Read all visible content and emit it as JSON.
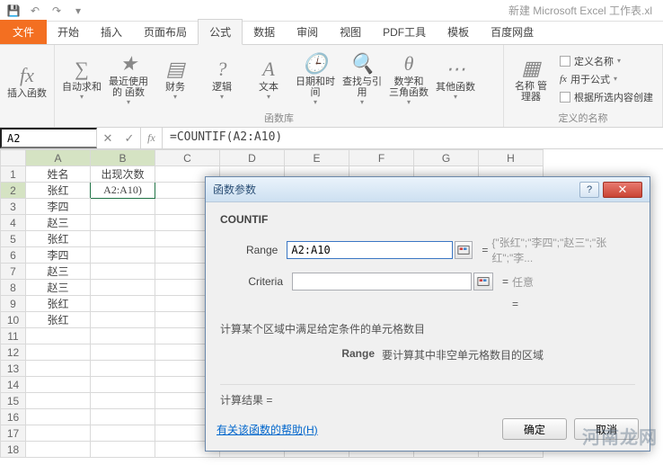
{
  "app": {
    "documentTitle": "新建 Microsoft Excel 工作表.xl"
  },
  "tabs": {
    "file": "文件",
    "home": "开始",
    "insert": "插入",
    "layout": "页面布局",
    "formulas": "公式",
    "data": "数据",
    "review": "审阅",
    "view": "视图",
    "pdf": "PDF工具",
    "template": "模板",
    "baidu": "百度网盘"
  },
  "ribbon": {
    "insertFn": "插入函数",
    "autoSum": "自动求和",
    "recent": "最近使用的\n函数",
    "financial": "财务",
    "logical": "逻辑",
    "text": "文本",
    "dateTime": "日期和时间",
    "lookup": "查找与引用",
    "mathTrig": "数学和\n三角函数",
    "more": "其他函数",
    "libLabel": "函数库",
    "nameMgr": "名称\n管理器",
    "defineName": "定义名称",
    "useInFormula": "用于公式",
    "createFromSel": "根据所选内容创建",
    "namesLabel": "定义的名称"
  },
  "formulaBar": {
    "nameBox": "A2",
    "cancel": "✕",
    "enter": "✓",
    "fx": "fx",
    "formula": "=COUNTIF(A2:A10)"
  },
  "sheet": {
    "cols": [
      "A",
      "B",
      "C",
      "D",
      "E",
      "F",
      "G",
      "H"
    ],
    "header": {
      "a": "姓名",
      "b": "出现次数"
    },
    "b2": "A2:A10)",
    "names": [
      "张红",
      "李四",
      "赵三",
      "张红",
      "李四",
      "赵三",
      "赵三",
      "张红",
      "张红"
    ]
  },
  "dialog": {
    "title": "函数参数",
    "fnName": "COUNTIF",
    "args": {
      "range": {
        "label": "Range",
        "value": "A2:A10",
        "preview": "{\"张红\";\"李四\";\"赵三\";\"张红\";\"李..."
      },
      "criteria": {
        "label": "Criteria",
        "value": "",
        "preview": "任意"
      }
    },
    "resultEq": "=",
    "description": "计算某个区域中满足给定条件的单元格数目",
    "argDescLabel": "Range",
    "argDesc": "要计算其中非空单元格数目的区域",
    "resultLabel": "计算结果 =",
    "helpLink": "有关该函数的帮助(H)",
    "ok": "确定",
    "cancel": "取消"
  },
  "watermark": "河南龙网"
}
